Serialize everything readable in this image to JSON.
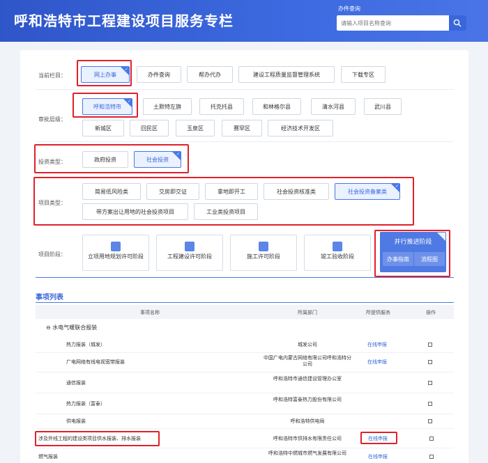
{
  "header": {
    "title": "呼和浩特市工程建设项目服务专栏",
    "query_label": "办件查询",
    "search_placeholder": "请输入项目名称查询"
  },
  "current_column": {
    "label": "当前栏目：",
    "items": [
      "网上办事",
      "办件查询",
      "帮办代办",
      "建设工程质量监督管理系统",
      "下载专区"
    ],
    "active": "网上办事"
  },
  "approval_level": {
    "label": "审批层级：",
    "row1": [
      "呼和浩特市",
      "土默特左旗",
      "托克托县",
      "和林格尔县",
      "清水河县",
      "武川县"
    ],
    "row2": [
      "新城区",
      "回民区",
      "玉泉区",
      "赛罕区",
      "经济技术开发区"
    ],
    "active": "呼和浩特市"
  },
  "investment_type": {
    "label": "投资类型：",
    "items": [
      "政府投资",
      "社会投资"
    ],
    "active": "社会投资"
  },
  "project_type": {
    "label": "项目类型：",
    "row1": [
      "简易低风险类",
      "交房即交证",
      "拿地即开工",
      "社会投资核准类",
      "社会投资备案类"
    ],
    "row2": [
      "带方案出让用地的社会投资项目",
      "工业类投资项目"
    ],
    "active": "社会投资备案类"
  },
  "project_stage": {
    "label": "项目阶段：",
    "items": [
      "立项用地规划许可阶段",
      "工程建设许可阶段",
      "施工许可阶段",
      "竣工验收阶段"
    ],
    "parallel": {
      "title": "并行推进阶段",
      "guide": "办事指南",
      "flow": "流程图"
    }
  },
  "matters": {
    "title": "事项列表",
    "columns": [
      "事项名称",
      "所属部门",
      "所提供服务",
      "操作"
    ],
    "group": "水电气暖联合报装",
    "rows": [
      {
        "name": "热力报装（城发）",
        "dept": "城发公司",
        "service": "在线申报"
      },
      {
        "name": "广电网络有线电视宽带报装",
        "dept": "中国广电内蒙古网络有限公司呼和浩特分公司",
        "service": "在线申报"
      },
      {
        "name": "通信报装",
        "dept": "呼和浩特市通信建设管理办公室",
        "service": ""
      },
      {
        "name": "热力报装（富泰）",
        "dept": "呼和浩特富泰热力股份有限公司",
        "service": ""
      },
      {
        "name": "供电报装",
        "dept": "呼和浩特供电局",
        "service": ""
      },
      {
        "name": "涉及外线工程的建设类项目供水报装、排水报装",
        "dept": "呼和浩特市供排水有限责任公司",
        "service": "在线申报"
      },
      {
        "name": "燃气报装",
        "dept": "呼和浩特中燃城市燃气发展有限公司",
        "service": "在线申报"
      }
    ]
  }
}
